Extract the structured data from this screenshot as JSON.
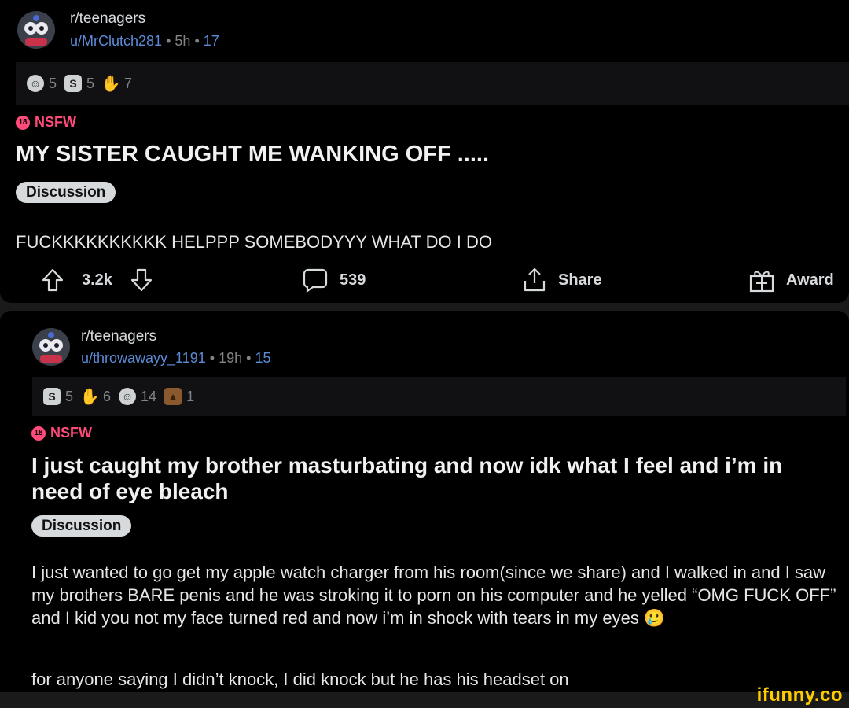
{
  "post1": {
    "subreddit": "r/teenagers",
    "username": "u/MrClutch281",
    "age": "5h",
    "points": "17",
    "awards": [
      {
        "icon": "laughing-award-icon",
        "count": "5"
      },
      {
        "icon": "silver-award-icon",
        "count": "5"
      },
      {
        "icon": "facepalm-award-icon",
        "count": "7"
      }
    ],
    "nsfw_label": "NSFW",
    "nsfw_badge": "18",
    "title": "MY SISTER CAUGHT ME WANKING OFF .....",
    "flair": "Discussion",
    "body": "FUCKKKKKKKKKK HELPPP SOMEBODYYY WHAT DO I DO",
    "votes": "3.2k",
    "comments": "539",
    "share_label": "Share",
    "award_label": "Award"
  },
  "post2": {
    "subreddit": "r/teenagers",
    "username": "u/throwawayy_1191",
    "age": "19h",
    "points": "15",
    "awards": [
      {
        "icon": "silver-award-icon",
        "count": "5"
      },
      {
        "icon": "facepalm-award-icon",
        "count": "6"
      },
      {
        "icon": "laughing-award-icon",
        "count": "14"
      },
      {
        "icon": "poop-award-icon",
        "count": "1"
      }
    ],
    "nsfw_label": "NSFW",
    "nsfw_badge": "18",
    "title": "I just caught my brother masturbating and now idk what I feel and i’m in need of eye bleach",
    "flair": "Discussion",
    "body": "I just wanted to go get my apple watch charger from his room(since we share) and I walked in and I saw my brothers BARE penis and he was stroking it to porn on his computer and he yelled “OMG FUCK OFF” and I kid you not my face turned red and now i’m in shock with tears in my eyes 🥲",
    "body2": "for anyone saying I didn’t knock, I did knock but he has his headset on"
  },
  "separator": "•",
  "watermark": "ifunny.co",
  "colors": {
    "nsfw": "#ff4a7a",
    "link": "#5b8bd6",
    "watermark": "#ffcc00"
  }
}
